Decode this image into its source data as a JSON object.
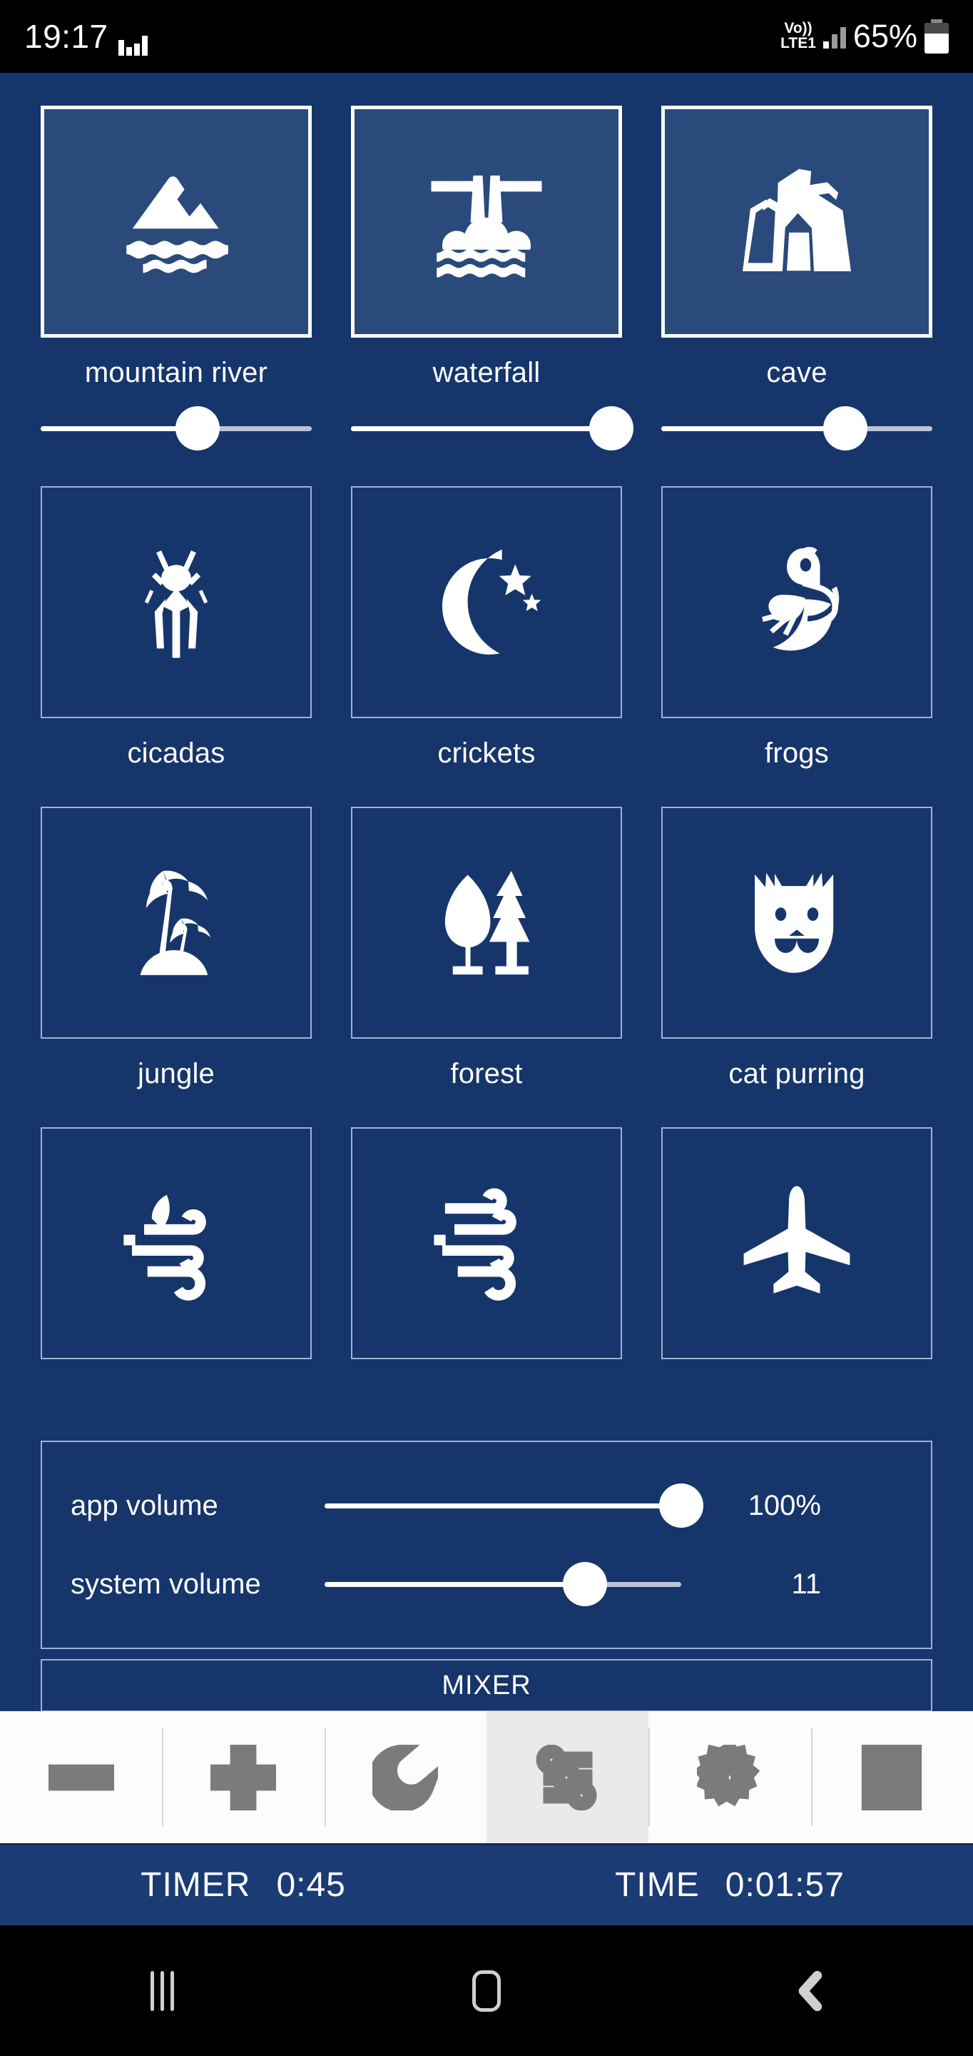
{
  "status_bar": {
    "clock": "19:17",
    "equalizer_icon": "equalizer-icon",
    "network_voice": "Vo))",
    "network_type": "LTE1",
    "signal_icon": "signal-bars-icon",
    "battery_percent": "65%",
    "battery_icon": "battery-icon"
  },
  "colors": {
    "app_background": "#16356b",
    "tile_active_background": "#2a4a7c",
    "tile_border": "#9fb2d4",
    "tile_active_border": "#ffffff",
    "accent_white": "#ffffff",
    "toolbar_background": "#fcfcfc",
    "toolbar_icon": "#7b7b7b",
    "toolbar_active_background": "#eaeaea",
    "timer_bar_background": "#1a3b74",
    "status_bar_background": "#000000"
  },
  "sounds": [
    {
      "id": "mountain-river",
      "label": "mountain river",
      "icon": "mountain-river-icon",
      "active": true,
      "has_slider": true,
      "volume_percent": 58
    },
    {
      "id": "waterfall",
      "label": "waterfall",
      "icon": "waterfall-icon",
      "active": true,
      "has_slider": true,
      "volume_percent": 96
    },
    {
      "id": "cave",
      "label": "cave",
      "icon": "cave-icon",
      "active": true,
      "has_slider": true,
      "volume_percent": 68
    },
    {
      "id": "cicadas",
      "label": "cicadas",
      "icon": "cicada-icon",
      "active": false,
      "has_slider": false,
      "volume_percent": 0
    },
    {
      "id": "crickets",
      "label": "crickets",
      "icon": "moon-stars-icon",
      "active": false,
      "has_slider": false,
      "volume_percent": 0
    },
    {
      "id": "frogs",
      "label": "frogs",
      "icon": "frog-icon",
      "active": false,
      "has_slider": false,
      "volume_percent": 0
    },
    {
      "id": "jungle",
      "label": "jungle",
      "icon": "palm-island-icon",
      "active": false,
      "has_slider": false,
      "volume_percent": 0
    },
    {
      "id": "forest",
      "label": "forest",
      "icon": "forest-trees-icon",
      "active": false,
      "has_slider": false,
      "volume_percent": 0
    },
    {
      "id": "cat-purring",
      "label": "cat purring",
      "icon": "cat-face-icon",
      "active": false,
      "has_slider": false,
      "volume_percent": 0
    },
    {
      "id": "wind-leaf",
      "label": "",
      "icon": "wind-leaf-icon",
      "active": false,
      "has_slider": false,
      "volume_percent": 0
    },
    {
      "id": "wind",
      "label": "",
      "icon": "wind-icon",
      "active": false,
      "has_slider": false,
      "volume_percent": 0
    },
    {
      "id": "airplane",
      "label": "",
      "icon": "airplane-icon",
      "active": false,
      "has_slider": false,
      "volume_percent": 0
    }
  ],
  "volume_panel": {
    "app_volume": {
      "label": "app volume",
      "value": "100%",
      "percent": 100
    },
    "system_volume": {
      "label": "system volume",
      "value": "11",
      "percent": 73
    }
  },
  "mixer_button": {
    "label": "MIXER"
  },
  "toolbar": [
    {
      "id": "minus",
      "icon": "minus-icon",
      "active": false
    },
    {
      "id": "plus",
      "icon": "plus-icon",
      "active": false
    },
    {
      "id": "moon",
      "icon": "moon-icon",
      "active": false
    },
    {
      "id": "mixer",
      "icon": "sliders-icon",
      "active": true
    },
    {
      "id": "gear",
      "icon": "gear-icon",
      "active": false
    },
    {
      "id": "pause",
      "icon": "pause-icon",
      "active": false
    }
  ],
  "timer_bar": {
    "timer_label": "TIMER",
    "timer_value": "0:45",
    "time_label": "TIME",
    "time_value": "0:01:57"
  },
  "nav_bar": {
    "recents_icon": "recents-icon",
    "home_icon": "home-icon",
    "back_icon": "back-icon"
  }
}
